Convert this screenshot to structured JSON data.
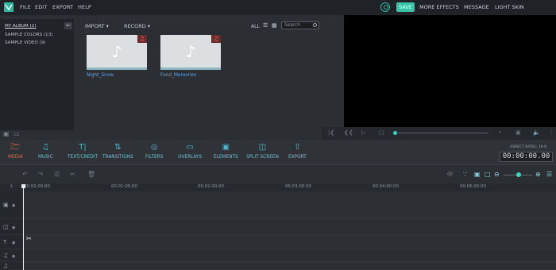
{
  "menu": {
    "file": "FILE",
    "edit": "EDIT",
    "export": "EXPORT",
    "help": "HELP"
  },
  "right_menu": {
    "save": "SAVE",
    "more_effects": "MORE EFFECTS",
    "message": "MESSAGE",
    "light_skin": "LIGHT SKIN"
  },
  "album": {
    "items": [
      "MY ALBUM (2)",
      "SAMPLE COLORS (13)",
      "SAMPLE VIDEO (9)"
    ]
  },
  "media": {
    "import": "IMPORT",
    "record": "RECORD",
    "all": "ALL",
    "search_placeholder": "Search",
    "files": [
      {
        "name": "Night_Snow"
      },
      {
        "name": "Fond_Memories"
      }
    ]
  },
  "toolbar": {
    "media": "MEDIA",
    "music": "MUSIC",
    "text": "TEXT/CREDIT",
    "transitions": "TRANSITIONS",
    "filters": "FILTERS",
    "overlays": "OVERLAYS",
    "elements": "ELEMENTS",
    "split": "SPLIT SCREEN",
    "export": "EXPORT",
    "aspect": "ASPECT RATIO: 16:9",
    "timecode": "00:00:00.00"
  },
  "ruler": [
    "00:00:00:00",
    "00:01:00:00",
    "00:02:00:00",
    "00:03:00:00",
    "00:04:00:00",
    "00:05:00:00"
  ],
  "colors": {
    "accent": "#35c4a8",
    "active_tool": "#e06a4d",
    "tool": "#46b8d1",
    "link": "#5fa4e6"
  },
  "icons": {
    "logo": "app-logo-icon",
    "user": "user-icon",
    "note": "music-note-icon",
    "playhead": "playhead-icon",
    "scissors": "scissors-icon"
  }
}
